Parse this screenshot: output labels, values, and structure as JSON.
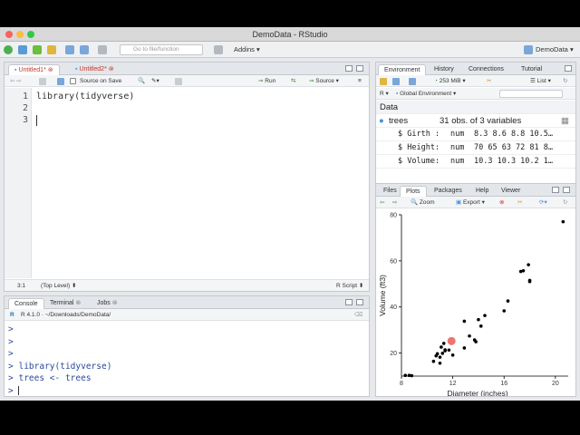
{
  "window": {
    "title": "DemoData - RStudio",
    "project": "DemoData"
  },
  "toolbar": {
    "goto_placeholder": "Go to file/function",
    "addins": "Addins"
  },
  "editor": {
    "tabs": [
      {
        "label": "Untitled1*"
      },
      {
        "label": "Untitled2*"
      }
    ],
    "source_on_save": "Source on Save",
    "run": "Run",
    "source": "Source",
    "lines": [
      "1",
      "2",
      "3"
    ],
    "code_line_1": "library(tidyverse)",
    "status_pos": "3:1",
    "status_level": "(Top Level)",
    "status_type": "R Script"
  },
  "console": {
    "tabs": [
      {
        "label": "Console"
      },
      {
        "label": "Terminal"
      },
      {
        "label": "Jobs"
      }
    ],
    "path": "R 4.1.0 · ~/Downloads/DemoData/",
    "prompt": ">",
    "lines": [
      "library(tidyverse)",
      "trees <- trees"
    ]
  },
  "environment": {
    "tabs": [
      {
        "label": "Environment"
      },
      {
        "label": "History"
      },
      {
        "label": "Connections"
      },
      {
        "label": "Tutorial"
      }
    ],
    "memory": "253 MiB",
    "list": "List",
    "lang": "R",
    "scope": "Global Environment",
    "section": "Data",
    "object_name": "trees",
    "object_desc": "31 obs. of 3 variables",
    "vars": [
      {
        "name": "$ Girth :",
        "type": "num",
        "values": "8.3 8.6 8.8 10.5…"
      },
      {
        "name": "$ Height:",
        "type": "num",
        "values": "70 65 63 72 81 8…"
      },
      {
        "name": "$ Volume:",
        "type": "num",
        "values": "10.3 10.3 10.2 1…"
      }
    ]
  },
  "files": {
    "tabs": [
      {
        "label": "Files"
      },
      {
        "label": "Plots"
      },
      {
        "label": "Packages"
      },
      {
        "label": "Help"
      },
      {
        "label": "Viewer"
      }
    ],
    "zoom": "Zoom",
    "export": "Export"
  },
  "colors": {
    "accent": "#4a90d9",
    "point": "#000000",
    "highlight": "#e8463e"
  },
  "chart_data": {
    "type": "scatter",
    "xlabel": "Diameter (inches)",
    "ylabel": "Volume (ft3)",
    "xlim": [
      8,
      21
    ],
    "ylim": [
      10,
      80
    ],
    "x_ticks": [
      8,
      12,
      16,
      20
    ],
    "y_ticks": [
      20,
      40,
      60,
      80
    ],
    "grid": false,
    "x": [
      8.3,
      8.6,
      8.8,
      10.5,
      10.7,
      10.8,
      11.0,
      11.0,
      11.1,
      11.2,
      11.3,
      11.4,
      11.4,
      11.7,
      12.0,
      12.9,
      12.9,
      13.3,
      13.7,
      13.8,
      14.0,
      14.2,
      14.5,
      16.0,
      16.3,
      17.3,
      17.5,
      17.9,
      18.0,
      18.0,
      20.6
    ],
    "y": [
      10.3,
      10.3,
      10.2,
      16.4,
      18.8,
      19.7,
      15.6,
      18.2,
      22.6,
      19.9,
      24.2,
      21.0,
      21.4,
      21.3,
      19.1,
      22.2,
      33.8,
      27.4,
      25.7,
      24.9,
      34.5,
      31.7,
      36.3,
      38.3,
      42.6,
      55.4,
      55.7,
      58.3,
      51.5,
      51.0,
      77.0
    ],
    "highlight": {
      "x": 11.9,
      "y": 25.2
    }
  }
}
